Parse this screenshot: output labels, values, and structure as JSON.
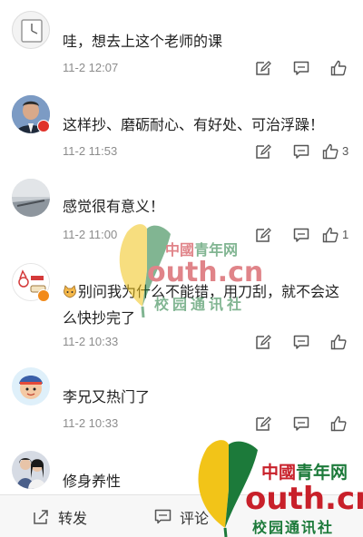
{
  "comments": [
    {
      "text": "哇，想去上这个老师的课",
      "time": "11-2 12:07",
      "likes": "",
      "avatar_icon": "clock-avatar"
    },
    {
      "text": "这样抄、磨砺耐心、有好处、可治浮躁！",
      "time": "11-2 11:53",
      "likes": "3",
      "avatar_icon": "man-portrait-avatar"
    },
    {
      "text": "感觉很有意义！",
      "time": "11-2 11:00",
      "likes": "1",
      "avatar_icon": "pier-landscape-avatar"
    },
    {
      "text": "别问我为什么不能错，用刀刮，就不会这么快抄完了",
      "time": "11-2 10:33",
      "likes": "",
      "avatar_icon": "cartoon-cat-avatar",
      "emoji_icon": "cat-emoji-icon"
    },
    {
      "text": "李兄又热门了",
      "time": "11-2 10:33",
      "likes": "",
      "avatar_icon": "cartoon-character-avatar"
    },
    {
      "text": "修身养性",
      "time": "",
      "likes": "",
      "avatar_icon": "couple-photo-avatar"
    }
  ],
  "bottom_bar": {
    "repost_label": "转发",
    "comment_label": "评论"
  },
  "watermark": {
    "center": {
      "china": "中國",
      "youth": "青年网",
      "domain": "outh.cn",
      "campus": "校园通讯社"
    },
    "corner": {
      "china": "中國",
      "youth": "青年网",
      "domain": "outh.cn",
      "campus": "校园通讯社"
    }
  },
  "colors": {
    "watermark_red": "#c8202a",
    "watermark_green": "#1c7a3a",
    "watermark_yellow": "#f2c418",
    "badge_orange": "#f28a1a",
    "badge_red": "#e0322a"
  }
}
